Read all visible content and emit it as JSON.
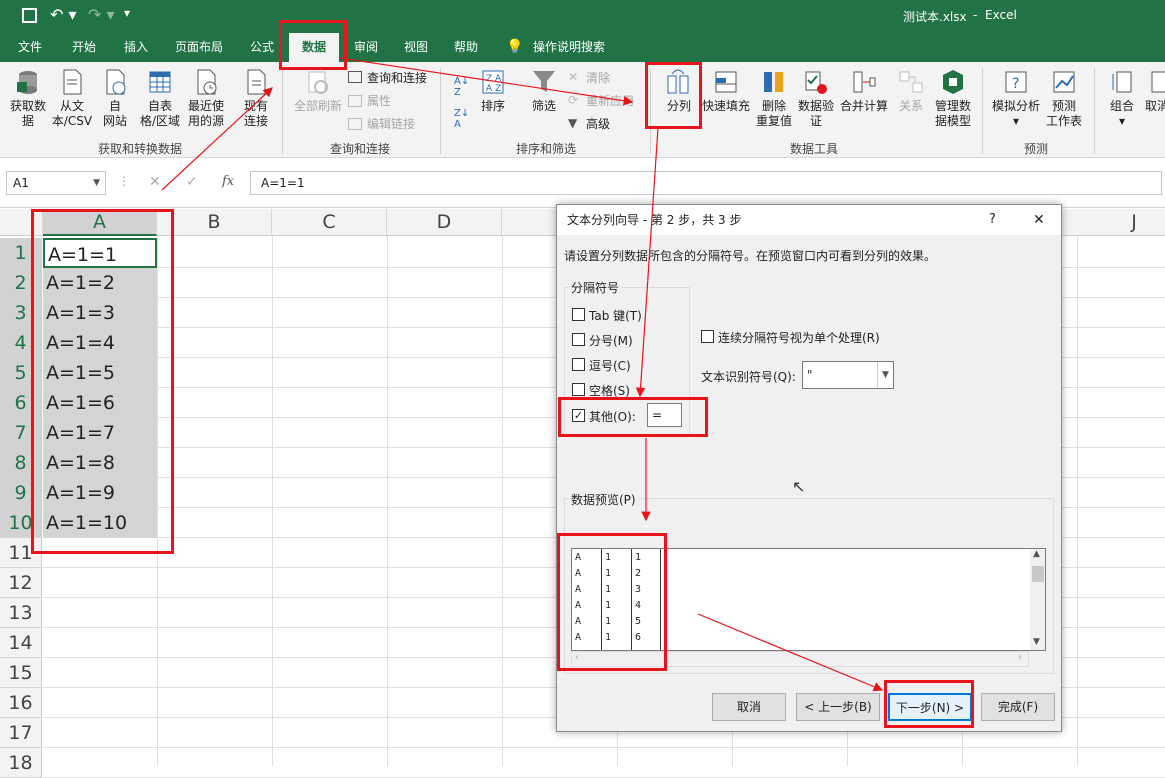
{
  "titlebar": {
    "filename": "测试本.xlsx",
    "sep": "-",
    "app": "Excel"
  },
  "tabs": [
    "文件",
    "开始",
    "插入",
    "页面布局",
    "公式",
    "数据",
    "审阅",
    "视图",
    "帮助",
    "操作说明搜索"
  ],
  "ribbon": {
    "get_data": "获取数据",
    "from_csv1": "从文",
    "from_csv2": "本/CSV",
    "web1": "自",
    "web2": "网站",
    "table1": "自表",
    "table2": "格/区域",
    "recent1": "最近使",
    "recent2": "用的源",
    "existing1": "现有",
    "existing2": "连接",
    "group_get": "获取和转换数据",
    "refresh_all": "全部刷新",
    "queries": "查询和连接",
    "properties": "属性",
    "edit_links": "编辑链接",
    "group_queries": "查询和连接",
    "sort": "排序",
    "filter": "筛选",
    "clear": "清除",
    "reapply": "重新应用",
    "advanced": "高级",
    "group_sort": "排序和筛选",
    "text_to_col": "分列",
    "flash_fill": "快速填充",
    "remove_dup1": "删除",
    "remove_dup2": "重复值",
    "validation1": "数据验",
    "validation2": "证",
    "consolidate": "合并计算",
    "relations": "关系",
    "model1": "管理数",
    "model2": "据模型",
    "group_tools": "数据工具",
    "whatif": "模拟分析",
    "forecast1": "预测",
    "forecast2": "工作表",
    "group_forecast": "预测",
    "group1": "组合",
    "ungroup": "取消"
  },
  "formula": {
    "namebox": "A1",
    "fx": "fx",
    "value": "A=1=1"
  },
  "columns": [
    "A",
    "B",
    "C",
    "D",
    "J"
  ],
  "rows": [
    "1",
    "2",
    "3",
    "4",
    "5",
    "6",
    "7",
    "8",
    "9",
    "10",
    "11",
    "12",
    "13",
    "14",
    "15",
    "16",
    "17",
    "18"
  ],
  "cells": [
    "A=1=1",
    "A=1=2",
    "A=1=3",
    "A=1=4",
    "A=1=5",
    "A=1=6",
    "A=1=7",
    "A=1=8",
    "A=1=9",
    "A=1=10"
  ],
  "dialog": {
    "title": "文本分列向导 - 第 2 步，共 3 步",
    "help": "?",
    "close": "✕",
    "instruction": "请设置分列数据所包含的分隔符号。在预览窗口内可看到分列的效果。",
    "delim_group": "分隔符号",
    "tab": "Tab 键(T)",
    "semicolon": "分号(M)",
    "comma": "逗号(C)",
    "space": "空格(S)",
    "other": "其他(O):",
    "other_value": "=",
    "consecutive": "连续分隔符号视为单个处理(R)",
    "qualifier_label": "文本识别符号(Q):",
    "qualifier_value": "\"",
    "preview_label": "数据预览(P)",
    "preview_rows": [
      [
        "A",
        "1",
        "1"
      ],
      [
        "A",
        "1",
        "2"
      ],
      [
        "A",
        "1",
        "3"
      ],
      [
        "A",
        "1",
        "4"
      ],
      [
        "A",
        "1",
        "5"
      ],
      [
        "A",
        "1",
        "6"
      ]
    ],
    "cancel": "取消",
    "back": "< 上一步(B)",
    "next": "下一步(N) >",
    "finish": "完成(F)"
  },
  "colors": {
    "excel_green": "#217346",
    "highlight": "#e8141b"
  }
}
